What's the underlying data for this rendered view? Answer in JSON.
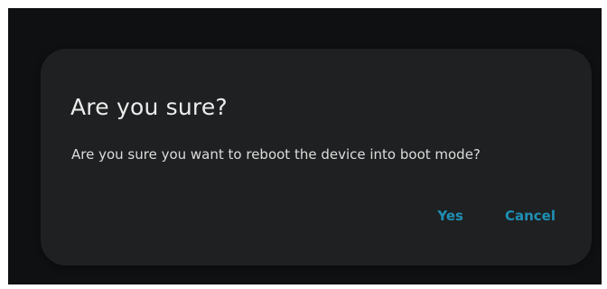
{
  "dialog": {
    "title": "Are you sure?",
    "message": "Are you sure you want to reboot the device into boot mode?",
    "yes_label": "Yes",
    "cancel_label": "Cancel"
  },
  "colors": {
    "background": "#0f1011",
    "dialog_surface": "#1f2021",
    "accent": "#1e8fb4"
  }
}
